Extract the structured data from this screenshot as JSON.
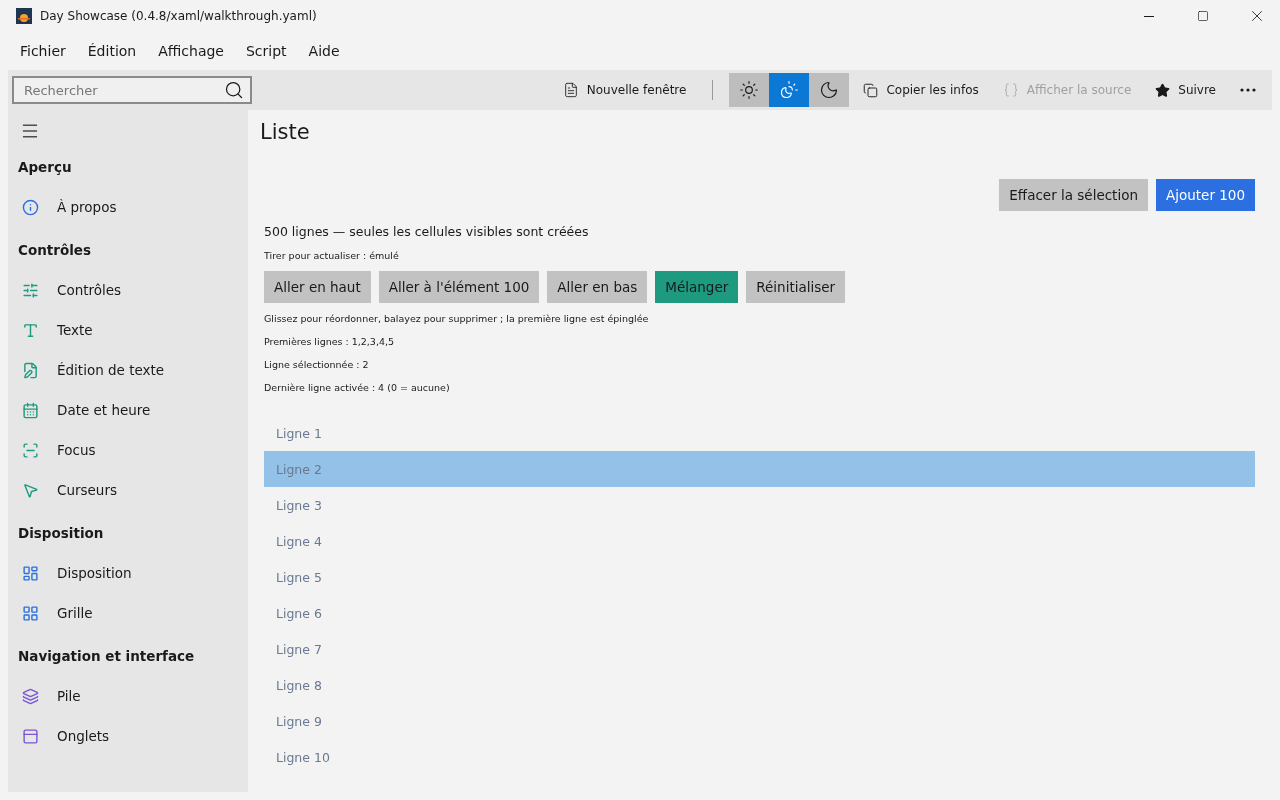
{
  "window": {
    "title": "Day Showcase (0.4.8/xaml/walkthrough.yaml)"
  },
  "menu": [
    "Fichier",
    "Édition",
    "Affichage",
    "Script",
    "Aide"
  ],
  "search": {
    "placeholder": "Rechercher"
  },
  "toolbar": {
    "new_window": "Nouvelle fenêtre",
    "themes": [
      {
        "kind": "light",
        "selected": false
      },
      {
        "kind": "contrast",
        "selected": true
      },
      {
        "kind": "dark",
        "selected": false
      }
    ],
    "copy": "Copier les infos",
    "source": {
      "label": "Afficher la source",
      "disabled": true
    },
    "follow": "Suivre"
  },
  "sidebar": {
    "sections": [
      {
        "title": "Aperçu",
        "items": [
          {
            "label": "À propos"
          }
        ]
      },
      {
        "title": "Contrôles",
        "items": [
          {
            "label": "Contrôles"
          },
          {
            "label": "Texte"
          },
          {
            "label": "Édition de texte"
          },
          {
            "label": "Date et heure"
          },
          {
            "label": "Focus"
          },
          {
            "label": "Curseurs"
          }
        ]
      },
      {
        "title": "Disposition",
        "items": [
          {
            "label": "Disposition"
          },
          {
            "label": "Grille"
          }
        ]
      },
      {
        "title": "Navigation et interface",
        "items": [
          {
            "label": "Pile"
          },
          {
            "label": "Onglets"
          }
        ]
      }
    ]
  },
  "page": {
    "title": "Liste",
    "top_buttons": [
      {
        "label": "Effacer la sélection",
        "kind": "secondary"
      },
      {
        "label": "Ajouter 100",
        "kind": "primary"
      }
    ],
    "summary": "500 lignes — seules les cellules visibles sont créées",
    "pull": "Tirer pour actualiser : émulé",
    "buttons": [
      {
        "label": "Aller en haut",
        "kind": "secondary"
      },
      {
        "label": "Aller à l'élément 100",
        "kind": "secondary"
      },
      {
        "label": "Aller en bas",
        "kind": "secondary"
      },
      {
        "label": "Mélanger",
        "kind": "accent"
      },
      {
        "label": "Réinitialiser",
        "kind": "secondary"
      }
    ],
    "info": [
      "Glissez pour réordonner, balayez pour supprimer ; la première ligne est épinglée",
      "Premières lignes : 1,2,3,4,5",
      "Ligne sélectionnée : 2",
      "Dernière ligne activée : 4 (0 = aucune)"
    ],
    "rows": [
      {
        "label": "Ligne 1",
        "selected": false
      },
      {
        "label": "Ligne 2",
        "selected": true
      },
      {
        "label": "Ligne 3",
        "selected": false
      },
      {
        "label": "Ligne 4",
        "selected": false
      },
      {
        "label": "Ligne 5",
        "selected": false
      },
      {
        "label": "Ligne 6",
        "selected": false
      },
      {
        "label": "Ligne 7",
        "selected": false
      },
      {
        "label": "Ligne 8",
        "selected": false
      },
      {
        "label": "Ligne 9",
        "selected": false
      },
      {
        "label": "Ligne 10",
        "selected": false
      }
    ]
  }
}
